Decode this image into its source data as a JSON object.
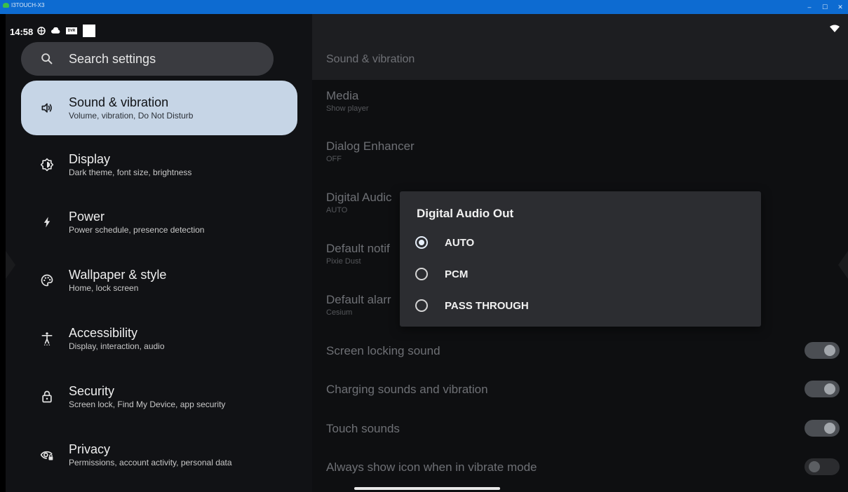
{
  "window": {
    "title": "I3TOUCH-X3",
    "controls": [
      "–",
      "☐",
      "✕"
    ]
  },
  "status": {
    "time": "14:58"
  },
  "search": {
    "placeholder": "Search settings"
  },
  "sidebar": {
    "items": [
      {
        "label": "Sound & vibration",
        "sub": "Volume, vibration, Do Not Disturb",
        "icon": "volume-icon"
      },
      {
        "label": "Display",
        "sub": "Dark theme, font size, brightness",
        "icon": "brightness-icon"
      },
      {
        "label": "Power",
        "sub": "Power schedule, presence detection",
        "icon": "power-bolt-icon"
      },
      {
        "label": "Wallpaper & style",
        "sub": "Home, lock screen",
        "icon": "palette-icon"
      },
      {
        "label": "Accessibility",
        "sub": "Display, interaction, audio",
        "icon": "accessibility-icon"
      },
      {
        "label": "Security",
        "sub": "Screen lock, Find My Device, app security",
        "icon": "lock-icon"
      },
      {
        "label": "Privacy",
        "sub": "Permissions, account activity, personal data",
        "icon": "privacy-eye-icon"
      }
    ]
  },
  "main": {
    "title": "Sound & vibration",
    "rows": [
      {
        "title": "Media",
        "sub": "Show player"
      },
      {
        "title": "Dialog Enhancer",
        "sub": "OFF"
      },
      {
        "title": "Digital Audic",
        "sub": "AUTO"
      },
      {
        "title": "Default notif",
        "sub": "Pixie Dust"
      },
      {
        "title": "Default alarr",
        "sub": "Cesium"
      }
    ],
    "toggles": [
      {
        "title": "Screen locking sound",
        "on": true
      },
      {
        "title": "Charging sounds and vibration",
        "on": true
      },
      {
        "title": "Touch sounds",
        "on": true
      },
      {
        "title": "Always show icon when in vibrate mode",
        "on": false
      }
    ]
  },
  "dialog": {
    "title": "Digital Audio Out",
    "options": [
      "AUTO",
      "PCM",
      "PASS THROUGH"
    ],
    "selected": "AUTO"
  }
}
